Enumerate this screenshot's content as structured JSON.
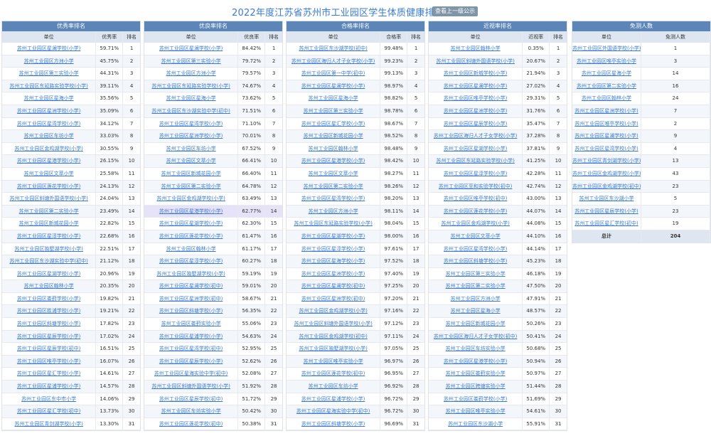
{
  "page_title": "2022年度江苏省苏州市工业园区学生体质健康排名公示",
  "up_button": "查看上一级公示",
  "panels": [
    {
      "title": "优秀率排名",
      "headers": [
        "单位",
        "优秀率",
        "排名"
      ],
      "rows": [
        [
          "苏州工业园区星澜学校(小学)",
          "59.71%",
          "1"
        ],
        [
          "苏州工业园区方洲小学",
          "45.75%",
          "2"
        ],
        [
          "苏州工业园区第三实验小学",
          "44.31%",
          "3"
        ],
        [
          "苏州工业园区东延路实验学校(小学)",
          "39.11%",
          "4"
        ],
        [
          "苏州工业园区星海小学",
          "35.56%",
          "5"
        ],
        [
          "苏州工业园区星洲学校(小学)",
          "35.09%",
          "6"
        ],
        [
          "苏州工业园区星湾学校(小学)",
          "34.12%",
          "7"
        ],
        [
          "苏州工业园区车坊小学",
          "33.03%",
          "8"
        ],
        [
          "苏州工业园区金鸡湖学校(小学)",
          "30.55%",
          "9"
        ],
        [
          "苏州工业园区星港学校(小学)",
          "26.15%",
          "10"
        ],
        [
          "苏州工业园区文萃小学",
          "25.58%",
          "11"
        ],
        [
          "苏州工业园区莲花学校(小学)",
          "24.13%",
          "12"
        ],
        [
          "苏州工业园区斜塘外国语学校(小学)",
          "24.04%",
          "13"
        ],
        [
          "苏州工业园区第二实验小学",
          "23.49%",
          "14"
        ],
        [
          "苏州工业园区新城花园小学",
          "22.82%",
          "15"
        ],
        [
          "苏州工业园区星淳学校(小学)",
          "22.68%",
          "16"
        ],
        [
          "苏州工业园区独墅湖学校(小学)",
          "22.51%",
          "17"
        ],
        [
          "苏州工业园区东沙湖实验中学(初中)",
          "21.12%",
          "18"
        ],
        [
          "苏州工业园区星湖学校(小学)",
          "20.96%",
          "19"
        ],
        [
          "苏州工业园区翰林小学",
          "20.35%",
          "20"
        ],
        [
          "苏州工业园区娄葑学校(小学)",
          "19.82%",
          "21"
        ],
        [
          "苏州工业园区胜浦学校(小学)",
          "19.21%",
          "22"
        ],
        [
          "苏州工业园区斜塘学校(小学)",
          "17.82%",
          "23"
        ],
        [
          "苏州工业园区星辰学校(小学)",
          "17.02%",
          "24"
        ],
        [
          "苏州工业园区星辰学校(初中)",
          "16.51%",
          "25"
        ],
        [
          "苏州工业园区唯亭学校(小学)",
          "16.07%",
          "26"
        ],
        [
          "苏州工业园区星汇学校(小学)",
          "14.61%",
          "27"
        ],
        [
          "苏州工业园区星浦学校(小学)",
          "14.57%",
          "28"
        ],
        [
          "苏州工业园区东中市小学",
          "14.06%",
          "29"
        ],
        [
          "苏州工业园区星汇学校(初中)",
          "13.73%",
          "30"
        ],
        [
          "苏州工业园区青剑湖学校(小学)",
          "13.30%",
          "31"
        ]
      ]
    },
    {
      "title": "优良率排名",
      "headers": [
        "单位",
        "优良率",
        "排名"
      ],
      "rows": [
        [
          "苏州工业园区星澜学校(小学)",
          "84.42%",
          "1"
        ],
        [
          "苏州工业园区第三实验小学",
          "79.72%",
          "2"
        ],
        [
          "苏州工业园区方洲小学",
          "79.57%",
          "3"
        ],
        [
          "苏州工业园区东延路实验学校(小学)",
          "74.67%",
          "4"
        ],
        [
          "苏州工业园区星海小学",
          "73.62%",
          "5"
        ],
        [
          "苏州工业园区东沙湖实验中学(初中)",
          "71.51%",
          "6"
        ],
        [
          "苏州工业园区星湾学校(小学)",
          "71.10%",
          "7"
        ],
        [
          "苏州工业园区星洲学校(小学)",
          "70.01%",
          "8"
        ],
        [
          "苏州工业园区车坊小学",
          "67.52%",
          "9"
        ],
        [
          "苏州工业园区文萃小学",
          "66.41%",
          "10"
        ],
        [
          "苏州工业园区新城花园小学",
          "66.40%",
          "11"
        ],
        [
          "苏州工业园区第二实验小学",
          "64.78%",
          "12"
        ],
        [
          "苏州工业园区金鸡湖学校(小学)",
          "63.49%",
          "13"
        ],
        [
          "苏州工业园区星港学校(小学)",
          "62.77%",
          "14"
        ],
        [
          "苏州工业园区星湖学校(小学)",
          "62.30%",
          "15"
        ],
        [
          "苏州工业园区莲花学校(小学)",
          "61.47%",
          "16"
        ],
        [
          "苏州工业园区翰林小学",
          "61.17%",
          "17"
        ],
        [
          "苏州工业园区星淳学校(小学)",
          "60.27%",
          "18"
        ],
        [
          "苏州工业园区独墅湖学校(小学)",
          "59.19%",
          "19"
        ],
        [
          "苏州工业园区星澜学校(初中)",
          "59.01%",
          "20"
        ],
        [
          "苏州工业园区星洲学校(初中)",
          "58.67%",
          "21"
        ],
        [
          "苏州工业园区斜塘学校(小学)",
          "56.35%",
          "22"
        ],
        [
          "苏州工业园区娄葑实验小学",
          "55.06%",
          "23"
        ],
        [
          "苏州工业园区星浦学校(小学)",
          "54.63%",
          "24"
        ],
        [
          "苏州工业园区星湾学校(初中)",
          "52.95%",
          "25"
        ],
        [
          "苏州工业园区星辰学校(小学)",
          "52.62%",
          "26"
        ],
        [
          "苏州工业园区星海实验中学(初中)",
          "52.08%",
          "27"
        ],
        [
          "苏州工业园区斜塘外国语学校(小学)",
          "51.92%",
          "28"
        ],
        [
          "苏州工业园区星辰学校(初中)",
          "51.72%",
          "29"
        ],
        [
          "苏州工业园区车坊实验小学",
          "50.42%",
          "30"
        ],
        [
          "苏州工业园区莲花学校(初中)",
          "50.38%",
          "31"
        ]
      ]
    },
    {
      "title": "合格率排名",
      "headers": [
        "单位",
        "合格率",
        "排名"
      ],
      "rows": [
        [
          "苏州工业园区东沙湖学校(初中)",
          "99.48%",
          "1"
        ],
        [
          "苏州工业园区海归人才子女学校(小学)",
          "99.23%",
          "2"
        ],
        [
          "苏州工业园区第一中学(初中)",
          "99.13%",
          "3"
        ],
        [
          "苏州工业园区星澜学校(小学)",
          "98.97%",
          "4"
        ],
        [
          "苏州工业园区星海小学",
          "98.82%",
          "5"
        ],
        [
          "苏州工业园区第三实验小学",
          "98.78%",
          "6"
        ],
        [
          "苏州工业园区星汇学校(小学)",
          "98.67%",
          "7"
        ],
        [
          "苏州工业园区新城花园小学",
          "98.52%",
          "8"
        ],
        [
          "苏州工业园区翰林小学",
          "98.48%",
          "9"
        ],
        [
          "苏州工业园区星港学校(小学)",
          "98.42%",
          "10"
        ],
        [
          "苏州工业园区文萃小学",
          "98.27%",
          "11"
        ],
        [
          "苏州工业园区第二实验小学",
          "98.26%",
          "12"
        ],
        [
          "苏州工业园区星湾学校(小学)",
          "98.20%",
          "13"
        ],
        [
          "苏州工业园区方洲小学",
          "98.11%",
          "14"
        ],
        [
          "苏州工业园区东延路实验学校(小学)",
          "98.04%",
          "15"
        ],
        [
          "苏州工业园区星湖学校(小学)",
          "98.00%",
          "16"
        ],
        [
          "苏州工业园区星淳学校(小学)",
          "97.61%",
          "17"
        ],
        [
          "苏州工业园区星海学校(小学)",
          "97.52%",
          "18"
        ],
        [
          "苏州工业园区星洲学校(小学)",
          "97.40%",
          "19"
        ],
        [
          "苏州工业园区星澜学校(初中)",
          "97.25%",
          "20"
        ],
        [
          "苏州工业园区星洲学校(初中)",
          "97.20%",
          "21"
        ],
        [
          "苏州工业园区金鸡湖学校(小学)",
          "97.16%",
          "22"
        ],
        [
          "苏州工业园区斜塘外国语学校(小学)",
          "97.12%",
          "23"
        ],
        [
          "苏州工业园区金鸡湖学校(初中)",
          "97.11%",
          "24"
        ],
        [
          "苏州工业园区独墅湖学校(小学)",
          "97.05%",
          "25"
        ],
        [
          "苏州工业园区唯亭实验小学",
          "96.97%",
          "26"
        ],
        [
          "苏州工业园区莲花学校(初中)",
          "96.95%",
          "27"
        ],
        [
          "苏州工业园区车坊小学",
          "96.92%",
          "28"
        ],
        [
          "苏州工业园区星浦学校(小学)",
          "96.72%",
          "29"
        ],
        [
          "苏州工业园区星海实验中学(初中)",
          "96.72%",
          "30"
        ],
        [
          "苏州工业园区斜塘学校(小学)",
          "96.69%",
          "31"
        ]
      ]
    },
    {
      "title": "近视率排名",
      "headers": [
        "单位",
        "近视率",
        "排名"
      ],
      "rows": [
        [
          "苏州工业园区翰林小学",
          "0.35%",
          "1"
        ],
        [
          "苏州工业园区斜塘外国语学校(小学)",
          "20.67%",
          "2"
        ],
        [
          "苏州工业园区新城学校(小学)",
          "21.94%",
          "3"
        ],
        [
          "苏州工业园区星澜学校(小学)",
          "27.02%",
          "4"
        ],
        [
          "苏州工业园区唯亭学校(小学)",
          "29.31%",
          "5"
        ],
        [
          "苏州工业园区星洲学校(小学)",
          "31.76%",
          "6"
        ],
        [
          "苏州工业园区星辰学校(小学)",
          "35.47%",
          "7"
        ],
        [
          "苏州工业园区海归人才子女学校(小学)",
          "37.28%",
          "8"
        ],
        [
          "苏州工业园区星湖学校(小学)",
          "37.81%",
          "9"
        ],
        [
          "苏州工业园区东延路实验学校(小学)",
          "41.25%",
          "10"
        ],
        [
          "苏州工业园区星淳学校(小学)",
          "42.28%",
          "11"
        ],
        [
          "苏州工业园区至和实验学校(初中)",
          "42.74%",
          "12"
        ],
        [
          "苏州工业园区唯亭学校(初中)",
          "43.00%",
          "13"
        ],
        [
          "苏州工业园区莲花学校(小学)",
          "44.07%",
          "14"
        ],
        [
          "苏州工业园区金鸡湖学校(小学)",
          "44.08%",
          "15"
        ],
        [
          "苏州工业园区文萃小学",
          "44.10%",
          "16"
        ],
        [
          "苏州工业园区星湾学校(小学)",
          "44.14%",
          "17"
        ],
        [
          "苏州工业园区斜塘学校(小学)",
          "45.23%",
          "18"
        ],
        [
          "苏州工业园区第三实验小学",
          "46.18%",
          "19"
        ],
        [
          "苏州工业园区第二实验小学",
          "47.50%",
          "20"
        ],
        [
          "苏州工业园区方洲小学",
          "47.91%",
          "21"
        ],
        [
          "苏州工业园区星海小学",
          "48.57%",
          "22"
        ],
        [
          "苏州工业园区新城花园小学",
          "50.26%",
          "23"
        ],
        [
          "苏州工业园区海归人才子女学校(初中)",
          "50.41%",
          "24"
        ],
        [
          "苏州工业园区车坊实验小学",
          "50.68%",
          "25"
        ],
        [
          "苏州工业园区星港学校(小学)",
          "50.94%",
          "26"
        ],
        [
          "苏州工业园区娄葑实验小学",
          "50.97%",
          "27"
        ],
        [
          "苏州工业园区跨塘实验小学",
          "51.44%",
          "28"
        ],
        [
          "苏州工业园区娄葑学校(小学)",
          "51.69%",
          "29"
        ],
        [
          "苏州工业园区唯亭实验小学",
          "54.61%",
          "30"
        ],
        [
          "苏州工业园区东沙湖小学",
          "55.91%",
          "31"
        ]
      ]
    }
  ],
  "exempt_panel": {
    "title": "免测人数",
    "headers": [
      "单位",
      "免测人数"
    ],
    "rows": [
      [
        "苏州工业园区外国语学校(小学)",
        "1"
      ],
      [
        "苏州工业园区唯亭实验小学",
        "3"
      ],
      [
        "苏州工业园区星海小学",
        "14"
      ],
      [
        "苏州工业园区第二实验小学",
        "16"
      ],
      [
        "苏州工业园区翰林小学",
        "24"
      ],
      [
        "苏州工业园区星洲学校(小学)",
        "7"
      ],
      [
        "苏州工业园区唯亭学校(小学)",
        "2"
      ],
      [
        "苏州工业园区星澜学校(小学)",
        "9"
      ],
      [
        "苏州工业园区星湾学校(小学)",
        "4"
      ],
      [
        "苏州工业园区青剑湖学校(小学)",
        "13"
      ],
      [
        "苏州工业园区金鸡湖学校(小学)",
        "43"
      ],
      [
        "苏州工业园区金鸡湖学校(初中)",
        "23"
      ],
      [
        "苏州工业园区东沙湖小学",
        "5"
      ],
      [
        "苏州工业园区星辰学校(小学)",
        "23"
      ],
      [
        "苏州工业园区星汇学校(初中)",
        "19"
      ]
    ],
    "total_label": "总计",
    "total_value": "204"
  }
}
